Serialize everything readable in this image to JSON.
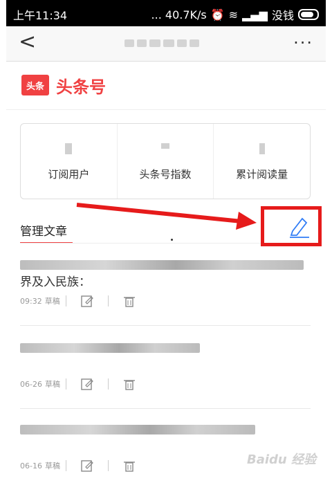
{
  "status_bar": {
    "time": "上午11:34",
    "network": "... 40.7K/s",
    "signal_text": "没钱"
  },
  "nav": {
    "back_glyph": "<",
    "more_glyph": "···"
  },
  "brand": {
    "logo_text": "头条",
    "name": "头条号",
    "color": "#f04142"
  },
  "stats": [
    {
      "label": "订阅用户"
    },
    {
      "label": "头条号指数"
    },
    {
      "label": "累计阅读量"
    }
  ],
  "section": {
    "title": "管理文章"
  },
  "articles": [
    {
      "title_tail": "界及入民族：",
      "date": "09:32",
      "status": "草稿"
    },
    {
      "title_tail": "",
      "date": "06-26",
      "status": "草稿"
    },
    {
      "title_tail": "",
      "date": "06-16",
      "status": "草稿"
    }
  ],
  "watermark": "Baidu 经验",
  "colors": {
    "accent": "#f04142",
    "highlight": "#e61b1b",
    "pen": "#2f7cf6"
  }
}
